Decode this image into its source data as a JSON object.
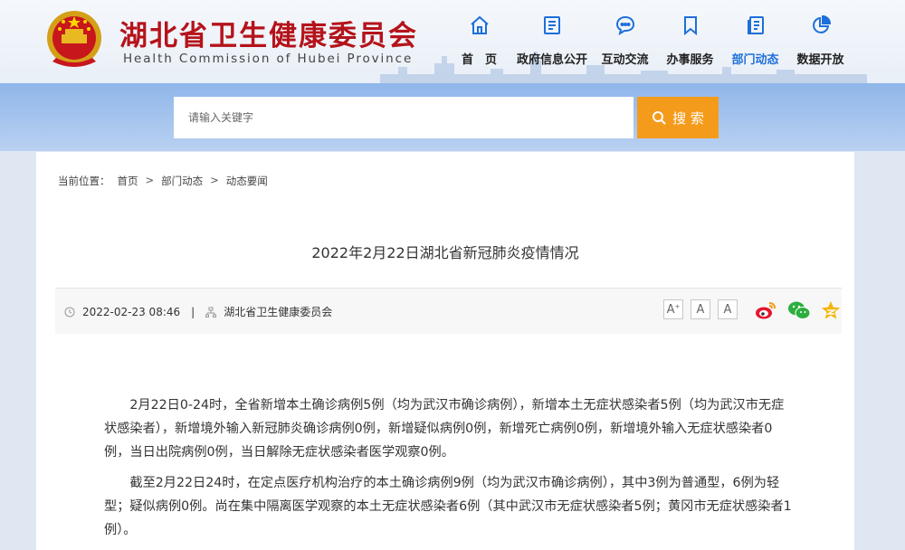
{
  "header": {
    "title_cn": "湖北省卫生健康委员会",
    "title_en": "Health Commission of Hubei Province",
    "nav": [
      {
        "label": "首　页",
        "icon": "home-icon"
      },
      {
        "label": "政府信息公开",
        "icon": "document-icon"
      },
      {
        "label": "互动交流",
        "icon": "chat-icon"
      },
      {
        "label": "办事服务",
        "icon": "bookmark-icon"
      },
      {
        "label": "部门动态",
        "icon": "news-icon",
        "active": true
      },
      {
        "label": "数据开放",
        "icon": "pie-chart-icon"
      }
    ]
  },
  "search": {
    "placeholder": "请输入关键字",
    "button": "搜 索"
  },
  "breadcrumb": {
    "prefix": "当前位置：",
    "items": [
      "首页",
      "部门动态",
      "动态要闻"
    ],
    "separator": ">"
  },
  "article": {
    "title": "2022年2月22日湖北省新冠肺炎疫情情况",
    "date": "2022-02-23 08:46",
    "divider": "|",
    "source": "湖北省卫生健康委员会",
    "font_buttons": [
      "A+",
      "A",
      "A"
    ],
    "paragraphs": [
      "2月22日0-24时，全省新增本土确诊病例5例（均为武汉市确诊病例），新增本土无症状感染者5例（均为武汉市无症状感染者），新增境外输入新冠肺炎确诊病例0例，新增疑似病例0例，新增死亡病例0例，新增境外输入无症状感染者0例，当日出院病例0例，当日解除无症状感染者医学观察0例。",
      "截至2月22日24时，在定点医疗机构治疗的本土确诊病例9例（均为武汉市确诊病例），其中3例为普通型，6例为轻型；疑似病例0例。尚在集中隔离医学观察的本土无症状感染者6例（其中武汉市无症状感染者5例；黄冈市无症状感染者1例）。"
    ]
  },
  "colors": {
    "brand_red": "#b5131b",
    "accent_blue": "#1e6fd9",
    "search_orange": "#f59b1c"
  }
}
